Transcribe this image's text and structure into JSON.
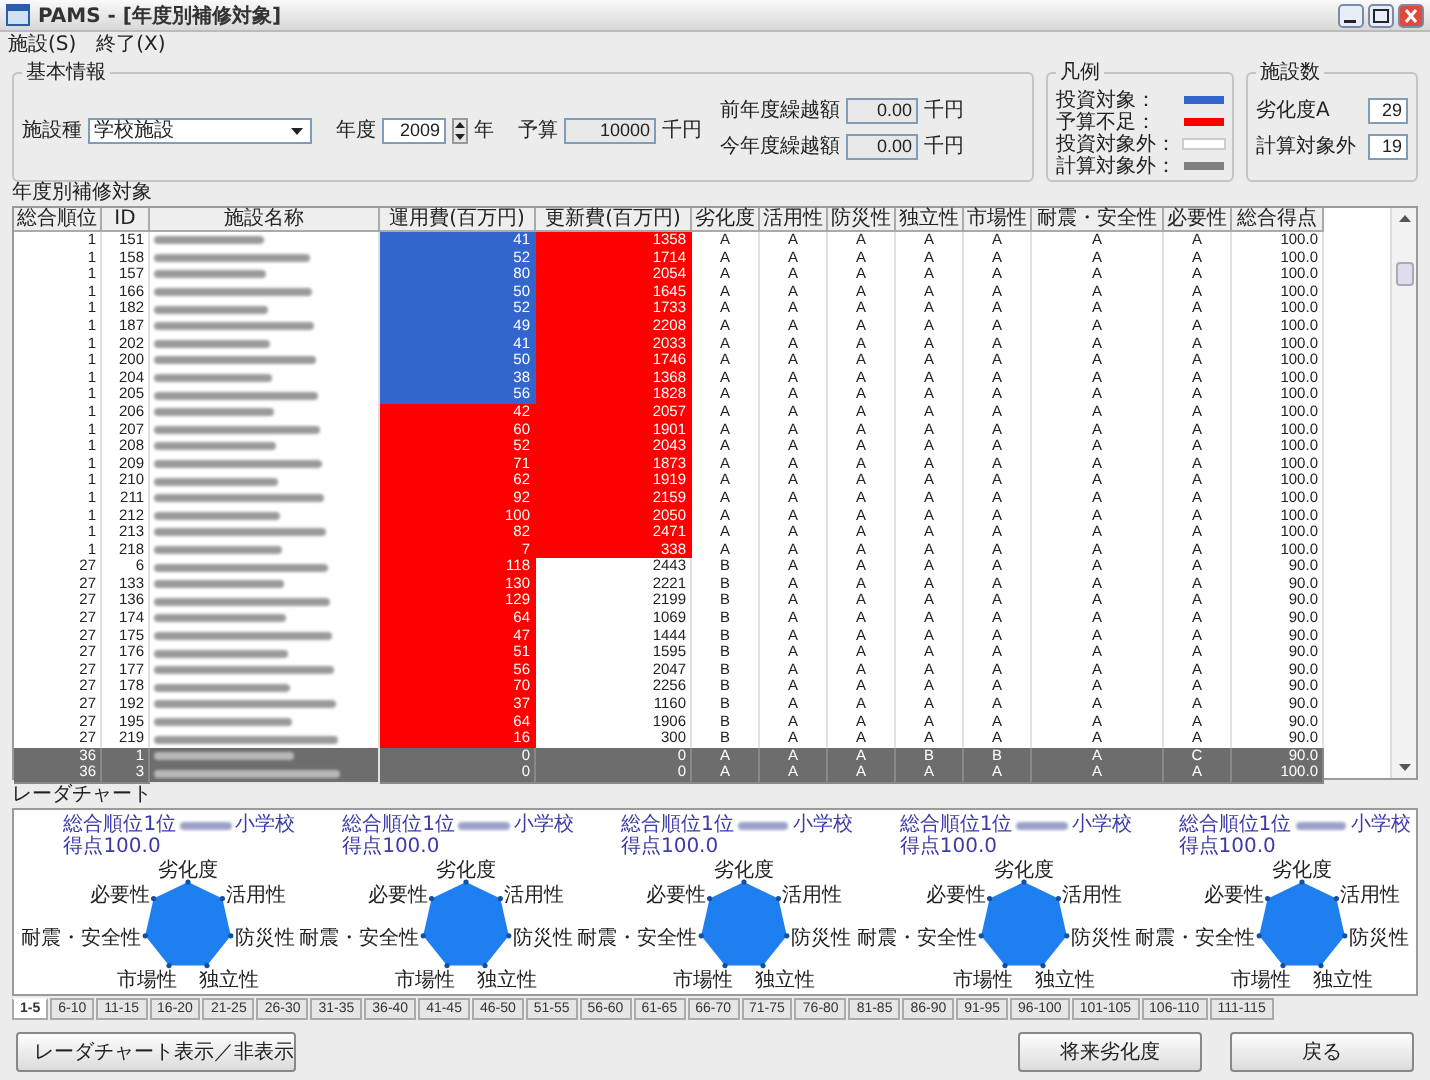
{
  "window": {
    "title": "PAMS - [年度別補修対象]"
  },
  "menu": [
    "施設(S)",
    "終了(X)"
  ],
  "basic_info": {
    "title": "基本情報",
    "facility_type": {
      "label": "施設種",
      "value": "学校施設"
    },
    "year": {
      "label": "年度",
      "value": "2009",
      "unit": "年"
    },
    "budget": {
      "label": "予算",
      "value": "10000",
      "unit": "千円"
    },
    "carryover": [
      {
        "label": "前年度繰越額",
        "value": "0.00",
        "unit": "千円"
      },
      {
        "label": "今年度繰越額",
        "value": "0.00",
        "unit": "千円"
      }
    ]
  },
  "legend": {
    "title": "凡例",
    "items": [
      {
        "label": "投資対象：",
        "color": "#3366cc"
      },
      {
        "label": "予算不足：",
        "color": "#ff0000"
      },
      {
        "label": "投資対象外：",
        "color": "#ffffff"
      },
      {
        "label": "計算対象外：",
        "color": "#808080"
      }
    ]
  },
  "facility_count": {
    "title": "施設数",
    "items": [
      {
        "label": "劣化度A",
        "value": "29"
      },
      {
        "label": "計算対象外",
        "value": "19"
      }
    ]
  },
  "table": {
    "title": "年度別補修対象",
    "columns": [
      "総合順位",
      "ID",
      "施設名称",
      "運用費(百万円)",
      "更新費(百万円)",
      "劣化度",
      "活用性",
      "防災性",
      "独立性",
      "市場性",
      "耐震・安全性",
      "必要性",
      "総合得点"
    ],
    "rows": [
      {
        "rank": "1",
        "id": "151",
        "operation": {
          "value": "41",
          "kind": "invest"
        },
        "renewal": {
          "value": "1358",
          "kind": "shortage"
        },
        "grades": [
          "A",
          "A",
          "A",
          "A",
          "A",
          "A",
          "A"
        ],
        "score": "100.0",
        "excluded": false
      },
      {
        "rank": "1",
        "id": "158",
        "operation": {
          "value": "52",
          "kind": "invest"
        },
        "renewal": {
          "value": "1714",
          "kind": "shortage"
        },
        "grades": [
          "A",
          "A",
          "A",
          "A",
          "A",
          "A",
          "A"
        ],
        "score": "100.0",
        "excluded": false
      },
      {
        "rank": "1",
        "id": "157",
        "operation": {
          "value": "80",
          "kind": "invest"
        },
        "renewal": {
          "value": "2054",
          "kind": "shortage"
        },
        "grades": [
          "A",
          "A",
          "A",
          "A",
          "A",
          "A",
          "A"
        ],
        "score": "100.0",
        "excluded": false
      },
      {
        "rank": "1",
        "id": "166",
        "operation": {
          "value": "50",
          "kind": "invest"
        },
        "renewal": {
          "value": "1645",
          "kind": "shortage"
        },
        "grades": [
          "A",
          "A",
          "A",
          "A",
          "A",
          "A",
          "A"
        ],
        "score": "100.0",
        "excluded": false
      },
      {
        "rank": "1",
        "id": "182",
        "operation": {
          "value": "52",
          "kind": "invest"
        },
        "renewal": {
          "value": "1733",
          "kind": "shortage"
        },
        "grades": [
          "A",
          "A",
          "A",
          "A",
          "A",
          "A",
          "A"
        ],
        "score": "100.0",
        "excluded": false
      },
      {
        "rank": "1",
        "id": "187",
        "operation": {
          "value": "49",
          "kind": "invest"
        },
        "renewal": {
          "value": "2208",
          "kind": "shortage"
        },
        "grades": [
          "A",
          "A",
          "A",
          "A",
          "A",
          "A",
          "A"
        ],
        "score": "100.0",
        "excluded": false
      },
      {
        "rank": "1",
        "id": "202",
        "operation": {
          "value": "41",
          "kind": "invest"
        },
        "renewal": {
          "value": "2033",
          "kind": "shortage"
        },
        "grades": [
          "A",
          "A",
          "A",
          "A",
          "A",
          "A",
          "A"
        ],
        "score": "100.0",
        "excluded": false
      },
      {
        "rank": "1",
        "id": "200",
        "operation": {
          "value": "50",
          "kind": "invest"
        },
        "renewal": {
          "value": "1746",
          "kind": "shortage"
        },
        "grades": [
          "A",
          "A",
          "A",
          "A",
          "A",
          "A",
          "A"
        ],
        "score": "100.0",
        "excluded": false
      },
      {
        "rank": "1",
        "id": "204",
        "operation": {
          "value": "38",
          "kind": "invest"
        },
        "renewal": {
          "value": "1368",
          "kind": "shortage"
        },
        "grades": [
          "A",
          "A",
          "A",
          "A",
          "A",
          "A",
          "A"
        ],
        "score": "100.0",
        "excluded": false
      },
      {
        "rank": "1",
        "id": "205",
        "operation": {
          "value": "56",
          "kind": "invest"
        },
        "renewal": {
          "value": "1828",
          "kind": "shortage"
        },
        "grades": [
          "A",
          "A",
          "A",
          "A",
          "A",
          "A",
          "A"
        ],
        "score": "100.0",
        "excluded": false
      },
      {
        "rank": "1",
        "id": "206",
        "operation": {
          "value": "42",
          "kind": "shortage"
        },
        "renewal": {
          "value": "2057",
          "kind": "shortage"
        },
        "grades": [
          "A",
          "A",
          "A",
          "A",
          "A",
          "A",
          "A"
        ],
        "score": "100.0",
        "excluded": false
      },
      {
        "rank": "1",
        "id": "207",
        "operation": {
          "value": "60",
          "kind": "shortage"
        },
        "renewal": {
          "value": "1901",
          "kind": "shortage"
        },
        "grades": [
          "A",
          "A",
          "A",
          "A",
          "A",
          "A",
          "A"
        ],
        "score": "100.0",
        "excluded": false
      },
      {
        "rank": "1",
        "id": "208",
        "operation": {
          "value": "52",
          "kind": "shortage"
        },
        "renewal": {
          "value": "2043",
          "kind": "shortage"
        },
        "grades": [
          "A",
          "A",
          "A",
          "A",
          "A",
          "A",
          "A"
        ],
        "score": "100.0",
        "excluded": false
      },
      {
        "rank": "1",
        "id": "209",
        "operation": {
          "value": "71",
          "kind": "shortage"
        },
        "renewal": {
          "value": "1873",
          "kind": "shortage"
        },
        "grades": [
          "A",
          "A",
          "A",
          "A",
          "A",
          "A",
          "A"
        ],
        "score": "100.0",
        "excluded": false
      },
      {
        "rank": "1",
        "id": "210",
        "operation": {
          "value": "62",
          "kind": "shortage"
        },
        "renewal": {
          "value": "1919",
          "kind": "shortage"
        },
        "grades": [
          "A",
          "A",
          "A",
          "A",
          "A",
          "A",
          "A"
        ],
        "score": "100.0",
        "excluded": false
      },
      {
        "rank": "1",
        "id": "211",
        "operation": {
          "value": "92",
          "kind": "shortage"
        },
        "renewal": {
          "value": "2159",
          "kind": "shortage"
        },
        "grades": [
          "A",
          "A",
          "A",
          "A",
          "A",
          "A",
          "A"
        ],
        "score": "100.0",
        "excluded": false
      },
      {
        "rank": "1",
        "id": "212",
        "operation": {
          "value": "100",
          "kind": "shortage"
        },
        "renewal": {
          "value": "2050",
          "kind": "shortage"
        },
        "grades": [
          "A",
          "A",
          "A",
          "A",
          "A",
          "A",
          "A"
        ],
        "score": "100.0",
        "excluded": false
      },
      {
        "rank": "1",
        "id": "213",
        "operation": {
          "value": "82",
          "kind": "shortage"
        },
        "renewal": {
          "value": "2471",
          "kind": "shortage"
        },
        "grades": [
          "A",
          "A",
          "A",
          "A",
          "A",
          "A",
          "A"
        ],
        "score": "100.0",
        "excluded": false
      },
      {
        "rank": "1",
        "id": "218",
        "operation": {
          "value": "7",
          "kind": "shortage"
        },
        "renewal": {
          "value": "338",
          "kind": "shortage"
        },
        "grades": [
          "A",
          "A",
          "A",
          "A",
          "A",
          "A",
          "A"
        ],
        "score": "100.0",
        "excluded": false
      },
      {
        "rank": "27",
        "id": "6",
        "operation": {
          "value": "118",
          "kind": "shortage"
        },
        "renewal": {
          "value": "2443",
          "kind": "none"
        },
        "grades": [
          "B",
          "A",
          "A",
          "A",
          "A",
          "A",
          "A"
        ],
        "score": "90.0",
        "excluded": false
      },
      {
        "rank": "27",
        "id": "133",
        "operation": {
          "value": "130",
          "kind": "shortage"
        },
        "renewal": {
          "value": "2221",
          "kind": "none"
        },
        "grades": [
          "B",
          "A",
          "A",
          "A",
          "A",
          "A",
          "A"
        ],
        "score": "90.0",
        "excluded": false
      },
      {
        "rank": "27",
        "id": "136",
        "operation": {
          "value": "129",
          "kind": "shortage"
        },
        "renewal": {
          "value": "2199",
          "kind": "none"
        },
        "grades": [
          "B",
          "A",
          "A",
          "A",
          "A",
          "A",
          "A"
        ],
        "score": "90.0",
        "excluded": false
      },
      {
        "rank": "27",
        "id": "174",
        "operation": {
          "value": "64",
          "kind": "shortage"
        },
        "renewal": {
          "value": "1069",
          "kind": "none"
        },
        "grades": [
          "B",
          "A",
          "A",
          "A",
          "A",
          "A",
          "A"
        ],
        "score": "90.0",
        "excluded": false
      },
      {
        "rank": "27",
        "id": "175",
        "operation": {
          "value": "47",
          "kind": "shortage"
        },
        "renewal": {
          "value": "1444",
          "kind": "none"
        },
        "grades": [
          "B",
          "A",
          "A",
          "A",
          "A",
          "A",
          "A"
        ],
        "score": "90.0",
        "excluded": false
      },
      {
        "rank": "27",
        "id": "176",
        "operation": {
          "value": "51",
          "kind": "shortage"
        },
        "renewal": {
          "value": "1595",
          "kind": "none"
        },
        "grades": [
          "B",
          "A",
          "A",
          "A",
          "A",
          "A",
          "A"
        ],
        "score": "90.0",
        "excluded": false
      },
      {
        "rank": "27",
        "id": "177",
        "operation": {
          "value": "56",
          "kind": "shortage"
        },
        "renewal": {
          "value": "2047",
          "kind": "none"
        },
        "grades": [
          "B",
          "A",
          "A",
          "A",
          "A",
          "A",
          "A"
        ],
        "score": "90.0",
        "excluded": false
      },
      {
        "rank": "27",
        "id": "178",
        "operation": {
          "value": "70",
          "kind": "shortage"
        },
        "renewal": {
          "value": "2256",
          "kind": "none"
        },
        "grades": [
          "B",
          "A",
          "A",
          "A",
          "A",
          "A",
          "A"
        ],
        "score": "90.0",
        "excluded": false
      },
      {
        "rank": "27",
        "id": "192",
        "operation": {
          "value": "37",
          "kind": "shortage"
        },
        "renewal": {
          "value": "1160",
          "kind": "none"
        },
        "grades": [
          "B",
          "A",
          "A",
          "A",
          "A",
          "A",
          "A"
        ],
        "score": "90.0",
        "excluded": false
      },
      {
        "rank": "27",
        "id": "195",
        "operation": {
          "value": "64",
          "kind": "shortage"
        },
        "renewal": {
          "value": "1906",
          "kind": "none"
        },
        "grades": [
          "B",
          "A",
          "A",
          "A",
          "A",
          "A",
          "A"
        ],
        "score": "90.0",
        "excluded": false
      },
      {
        "rank": "27",
        "id": "219",
        "operation": {
          "value": "16",
          "kind": "shortage"
        },
        "renewal": {
          "value": "300",
          "kind": "none"
        },
        "grades": [
          "B",
          "A",
          "A",
          "A",
          "A",
          "A",
          "A"
        ],
        "score": "90.0",
        "excluded": false
      },
      {
        "rank": "36",
        "id": "1",
        "operation": {
          "value": "0",
          "kind": "none"
        },
        "renewal": {
          "value": "0",
          "kind": "none"
        },
        "grades": [
          "A",
          "A",
          "A",
          "B",
          "B",
          "A",
          "C"
        ],
        "score": "90.0",
        "excluded": true
      },
      {
        "rank": "36",
        "id": "3",
        "operation": {
          "value": "0",
          "kind": "none"
        },
        "renewal": {
          "value": "0",
          "kind": "none"
        },
        "grades": [
          "A",
          "A",
          "A",
          "A",
          "A",
          "A",
          "A"
        ],
        "score": "100.0",
        "excluded": true
      }
    ]
  },
  "radar": {
    "title": "レーダチャート",
    "charts": [
      {
        "rank_label": "総合順位1位",
        "school_suffix": "小学校",
        "score": "得点100.0",
        "axes": [
          "劣化度",
          "活用性",
          "防災性",
          "独立性",
          "市場性",
          "耐震・安全性",
          "必要性"
        ]
      },
      {
        "rank_label": "総合順位1位",
        "school_suffix": "小学校",
        "score": "得点100.0",
        "axes": [
          "劣化度",
          "活用性",
          "防災性",
          "独立性",
          "市場性",
          "耐震・安全性",
          "必要性"
        ]
      },
      {
        "rank_label": "総合順位1位",
        "school_suffix": "小学校",
        "score": "得点100.0",
        "axes": [
          "劣化度",
          "活用性",
          "防災性",
          "独立性",
          "市場性",
          "耐震・安全性",
          "必要性"
        ]
      },
      {
        "rank_label": "総合順位1位",
        "school_suffix": "小学校",
        "score": "得点100.0",
        "axes": [
          "劣化度",
          "活用性",
          "防災性",
          "独立性",
          "市場性",
          "耐震・安全性",
          "必要性"
        ]
      },
      {
        "rank_label": "総合順位1位",
        "school_suffix": "小学校",
        "score": "得点100.0",
        "axes": [
          "劣化度",
          "活用性",
          "防災性",
          "独立性",
          "市場性",
          "耐震・安全性",
          "必要性"
        ]
      }
    ],
    "tabs": [
      {
        "label": "1-5",
        "selected": true
      },
      {
        "label": "6-10",
        "selected": false
      },
      {
        "label": "11-15",
        "selected": false
      },
      {
        "label": "16-20",
        "selected": false
      },
      {
        "label": "21-25",
        "selected": false
      },
      {
        "label": "26-30",
        "selected": false
      },
      {
        "label": "31-35",
        "selected": false
      },
      {
        "label": "36-40",
        "selected": false
      },
      {
        "label": "41-45",
        "selected": false
      },
      {
        "label": "46-50",
        "selected": false
      },
      {
        "label": "51-55",
        "selected": false
      },
      {
        "label": "56-60",
        "selected": false
      },
      {
        "label": "61-65",
        "selected": false
      },
      {
        "label": "66-70",
        "selected": false
      },
      {
        "label": "71-75",
        "selected": false
      },
      {
        "label": "76-80",
        "selected": false
      },
      {
        "label": "81-85",
        "selected": false
      },
      {
        "label": "86-90",
        "selected": false
      },
      {
        "label": "91-95",
        "selected": false
      },
      {
        "label": "96-100",
        "selected": false
      },
      {
        "label": "101-105",
        "selected": false
      },
      {
        "label": "106-110",
        "selected": false
      },
      {
        "label": "111-115",
        "selected": false
      }
    ]
  },
  "buttons": [
    "レーダチャート表示／非表示",
    "将来劣化度",
    "戻る"
  ]
}
